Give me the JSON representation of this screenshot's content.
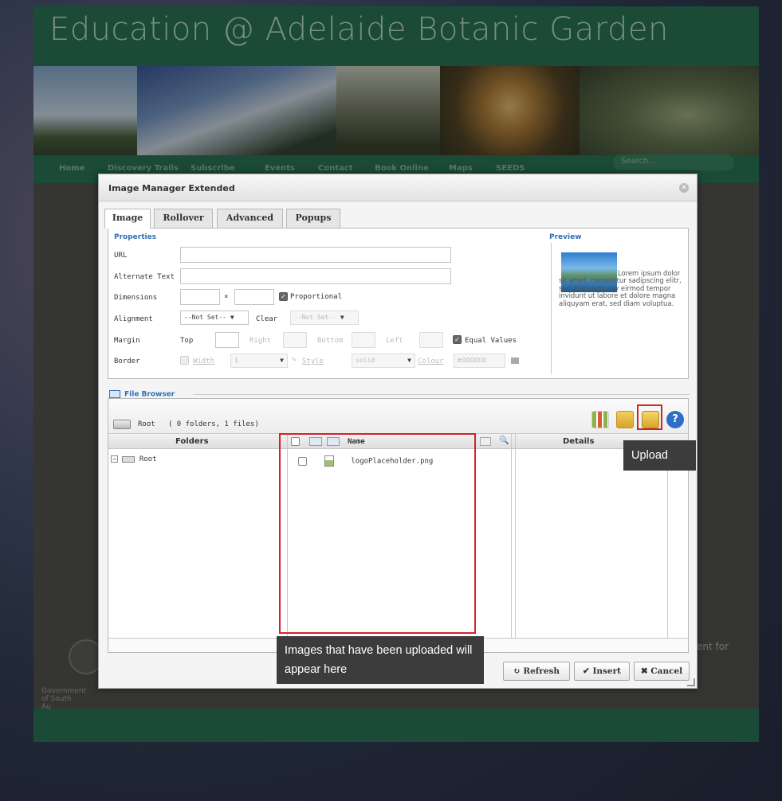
{
  "site": {
    "title": "Education @ Adelaide Botanic Garden",
    "nav": [
      "Home",
      "Discovery Trails",
      "Subscribe",
      "Events",
      "Contact",
      "Book Online",
      "Maps",
      "SEEDS"
    ],
    "search_placeholder": "Search...",
    "footer_gov": "Government of South Au",
    "footer_right": "ent for",
    "colors": {
      "header_green": "#1f6b4c",
      "nav_text": "#7fb59a"
    }
  },
  "dialog": {
    "title": "Image Manager Extended",
    "close_icon": "close-circle-icon",
    "tabs": [
      {
        "label": "Image",
        "active": true
      },
      {
        "label": "Rollover",
        "active": false
      },
      {
        "label": "Advanced",
        "active": false
      },
      {
        "label": "Popups",
        "active": false
      }
    ],
    "properties": {
      "title": "Properties",
      "url_label": "URL",
      "url_value": "",
      "alt_label": "Alternate Text",
      "alt_value": "",
      "dimensions_label": "Dimensions",
      "dimensions_times": "×",
      "proportional_label": "Proportional",
      "proportional_checked": true,
      "alignment_label": "Alignment",
      "alignment_value": "--Not Set--",
      "clear_label": "Clear",
      "clear_value": "--Not Set--",
      "margin_label": "Margin",
      "margin_top": "Top",
      "margin_right": "Right",
      "margin_bottom": "Bottom",
      "margin_left": "Left",
      "equal_values_label": "Equal Values",
      "equal_values_checked": true,
      "border_label": "Border",
      "border_width_label": "Width",
      "border_width_value": "1",
      "border_style_label": "Style",
      "border_style_value": "solid",
      "border_colour_label": "Colour",
      "border_colour_value": "#000000"
    },
    "preview": {
      "title": "Preview",
      "text": "Lorem ipsum dolor sit amet, consetetur sadipscing elitr, sed diam nonumy eirmod tempor invidunt ut labore et dolore magna aliquyam erat, sed diam voluptua."
    },
    "file_browser": {
      "legend": "File Browser",
      "path_root": "Root",
      "path_info": "( 0 folders, 1 files)",
      "columns": {
        "folders": "Folders",
        "name": "Name",
        "details": "Details"
      },
      "folders": [
        {
          "name": "Root"
        }
      ],
      "files": [
        {
          "name": "logoPlaceholder.png"
        }
      ],
      "toolbar_icons": [
        "view-toggle-icon",
        "new-folder-icon",
        "upload-icon",
        "help-icon"
      ]
    },
    "buttons": {
      "refresh": "↻ Refresh",
      "insert": "✔ Insert",
      "cancel": "✖ Cancel"
    }
  },
  "annotations": {
    "upload_label": "Upload",
    "images_label": "Images that have been uploaded will appear here",
    "highlight_color": "#d3222a"
  }
}
